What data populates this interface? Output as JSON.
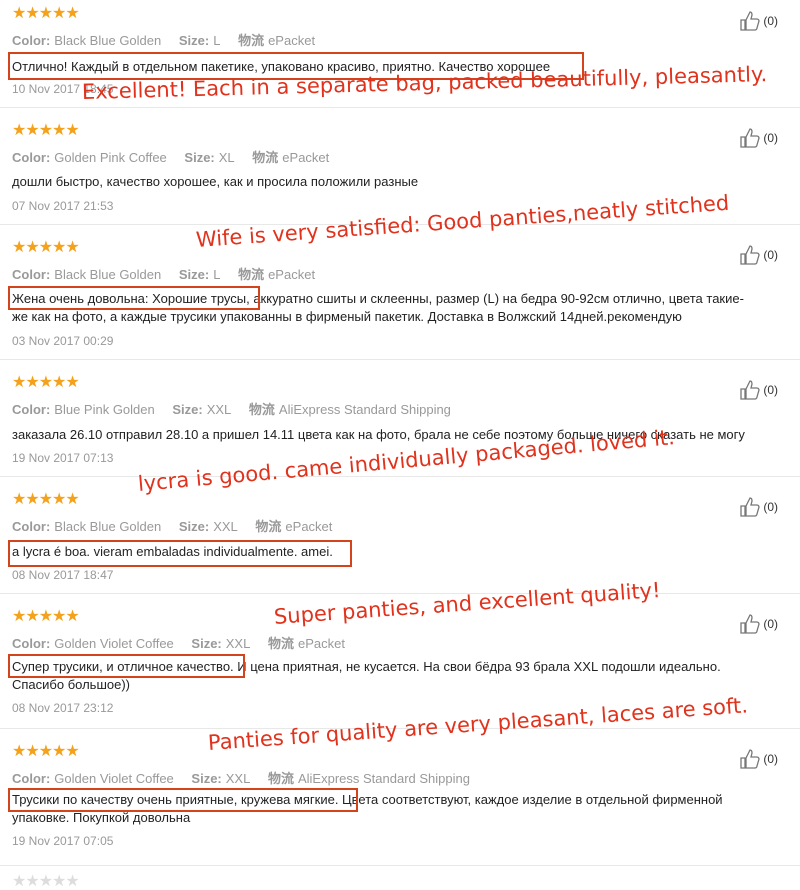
{
  "labels": {
    "color": "Color:",
    "size": "Size:",
    "shipping": "物流"
  },
  "stars": "★★★★★",
  "reviews": [
    {
      "color": "Black Blue Golden",
      "size": "L",
      "shipping": "ePacket",
      "text": "Отлично! Каждый в отдельном пакетике, упаковано красиво, приятно. Качество хорошее",
      "text2": "",
      "date": "10 Nov 2017 18:45",
      "likes": "(0)"
    },
    {
      "color": "Golden Pink Coffee",
      "size": "XL",
      "shipping": "ePacket",
      "text": "дошли быстро, качество хорошее, как и просила положили разные",
      "text2": "",
      "date": "07 Nov 2017 21:53",
      "likes": "(0)"
    },
    {
      "color": "Black Blue Golden",
      "size": "L",
      "shipping": "ePacket",
      "text": "Жена очень довольна: Хорошие трусы, аккуратно сшиты и склеенны, размер (L) на бедра 90-92см отлично, цвета такие-",
      "text2": "же как на фото, а каждые трусики упакованны в фирменый пакетик. Доставка в Волжский 14дней.рекомендую",
      "date": "03 Nov 2017 00:29",
      "likes": "(0)"
    },
    {
      "color": "Blue Pink Golden",
      "size": "XXL",
      "shipping": "AliExpress Standard Shipping",
      "text": "заказала 26.10 отправил 28.10 а пришел 14.11 цвета как на фото, брала не себе поэтому больше ничего сказать не могу",
      "text2": "",
      "date": "19 Nov 2017 07:13",
      "likes": "(0)"
    },
    {
      "color": "Black Blue Golden",
      "size": "XXL",
      "shipping": "ePacket",
      "text": "a lycra é boa. vieram embaladas individualmente. amei.",
      "text2": "",
      "date": "08 Nov 2017 18:47",
      "likes": "(0)"
    },
    {
      "color": "Golden Violet Coffee",
      "size": "XXL",
      "shipping": "ePacket",
      "text": "Супер трусики, и отличное качество. И цена приятная, не кусается. На свои бёдра 93 брала XXL подошли идеально.",
      "text2": "Спасибо большое))",
      "date": "08 Nov 2017 23:12",
      "likes": "(0)"
    },
    {
      "color": "Golden Violet Coffee",
      "size": "XXL",
      "shipping": "AliExpress Standard Shipping",
      "text": "Трусики по качеству очень приятные, кружева мягкие. Цвета соответствуют, каждое изделие в отдельной фирменной",
      "text2": "упаковке. Покупкой довольна",
      "date": "19 Nov 2017 07:05",
      "likes": "(0)"
    }
  ],
  "annotations": [
    "Excellent! Each in a separate bag, packed beautifully, pleasantly.",
    "Wife is very satisfied: Good panties,neatly stitched",
    "lycra is good. came individually packaged. loved it.",
    "Super panties, and excellent quality!",
    "Panties for quality are very pleasant, laces are soft."
  ]
}
